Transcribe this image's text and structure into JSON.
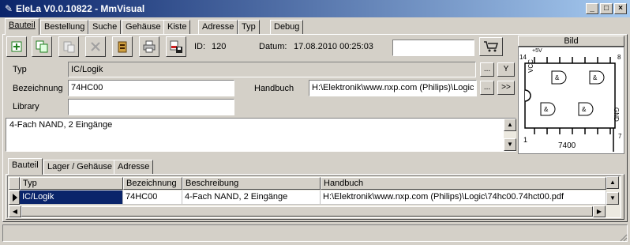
{
  "window": {
    "title": "EleLa V0.0.10822 - MmVisual",
    "minimize": "_",
    "maximize": "□",
    "close": "×"
  },
  "tabs": [
    {
      "label": "Bauteil"
    },
    {
      "label": "Bestellung"
    },
    {
      "label": "Suche"
    },
    {
      "label": "Gehäuse"
    },
    {
      "label": "Kiste"
    },
    {
      "label": "Adresse"
    },
    {
      "label": "Typ"
    },
    {
      "label": "Debug"
    }
  ],
  "record": {
    "id_label": "ID:",
    "id_value": "120",
    "date_label": "Datum:",
    "date_value": "17.08.2010 00:25:03"
  },
  "form": {
    "typ_label": "Typ",
    "typ_value": "IC/Logik",
    "bezeichnung_label": "Bezeichnung",
    "bezeichnung_value": "74HC00",
    "library_label": "Library",
    "library_value": "",
    "handbuch_label": "Handbuch",
    "handbuch_value": "H:\\Elektronik\\www.nxp.com (Philips)\\Logic",
    "ellipsis": "...",
    "y_button": "Y",
    "open_button": ">>",
    "description": "4-Fach NAND, 2 Eingänge"
  },
  "image_panel": {
    "header": "Bild",
    "pin14": "14",
    "pin8": "8",
    "pin1": "1",
    "pin7": "7",
    "vcc_note": "+5V",
    "vcc": "VCC",
    "gnd": "GND",
    "chip": "7400"
  },
  "inner_tabs": [
    {
      "label": "Bauteil"
    },
    {
      "label": "Lager / Gehäuse"
    },
    {
      "label": "Adresse"
    }
  ],
  "grid": {
    "columns": [
      "Typ",
      "Bezeichnung",
      "Beschreibung",
      "Handbuch"
    ],
    "rows": [
      [
        "IC/Logik",
        "74HC00",
        "4-Fach NAND, 2 Eingänge",
        "H:\\Elektronik\\www.nxp.com (Philips)\\Logic\\74hc00.74hct00.pdf"
      ]
    ]
  }
}
